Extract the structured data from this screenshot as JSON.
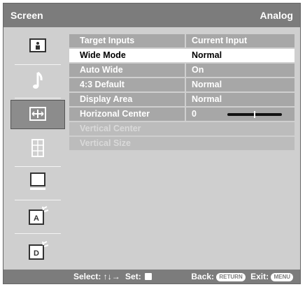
{
  "header": {
    "title": "Screen",
    "input_mode": "Analog"
  },
  "sidebar": {
    "items": [
      {
        "name": "picture",
        "icon": "picture-settings-icon"
      },
      {
        "name": "sound",
        "icon": "music-note-icon"
      },
      {
        "name": "screen",
        "icon": "screen-resize-icon",
        "selected": true
      },
      {
        "name": "setup",
        "icon": "grid-settings-icon"
      },
      {
        "name": "pc",
        "icon": "monitor-icon"
      },
      {
        "name": "analog",
        "icon": "analog-input-icon",
        "letter": "A"
      },
      {
        "name": "digital",
        "icon": "digital-input-icon",
        "letter": "D"
      }
    ]
  },
  "menu": {
    "rows": [
      {
        "label": "Target Inputs",
        "value": "Current Input"
      },
      {
        "label": "Wide Mode",
        "value": "Normal",
        "selected": true
      },
      {
        "label": "Auto Wide",
        "value": "On"
      },
      {
        "label": "4:3 Default",
        "value": "Normal"
      },
      {
        "label": "Display Area",
        "value": "Normal"
      },
      {
        "label": "Horizonal Center",
        "value": "0",
        "slider": true,
        "slider_level": 0.5
      },
      {
        "label": "Vertical Center",
        "value": "",
        "disabled": true
      },
      {
        "label": "Vertical Size",
        "value": "",
        "disabled": true
      }
    ]
  },
  "footer": {
    "select_label": "Select:",
    "select_keys": "↑↓→",
    "set_label": "Set:",
    "back_label": "Back:",
    "back_key": "RETURN",
    "exit_label": "Exit:",
    "exit_key": "MENU"
  },
  "colors": {
    "osd_bg": "#cfcfcf",
    "bar": "#7c7c7c",
    "row": "#a7a7a7",
    "row_selected": "#ffffff",
    "row_disabled": "#bcbcbc"
  }
}
